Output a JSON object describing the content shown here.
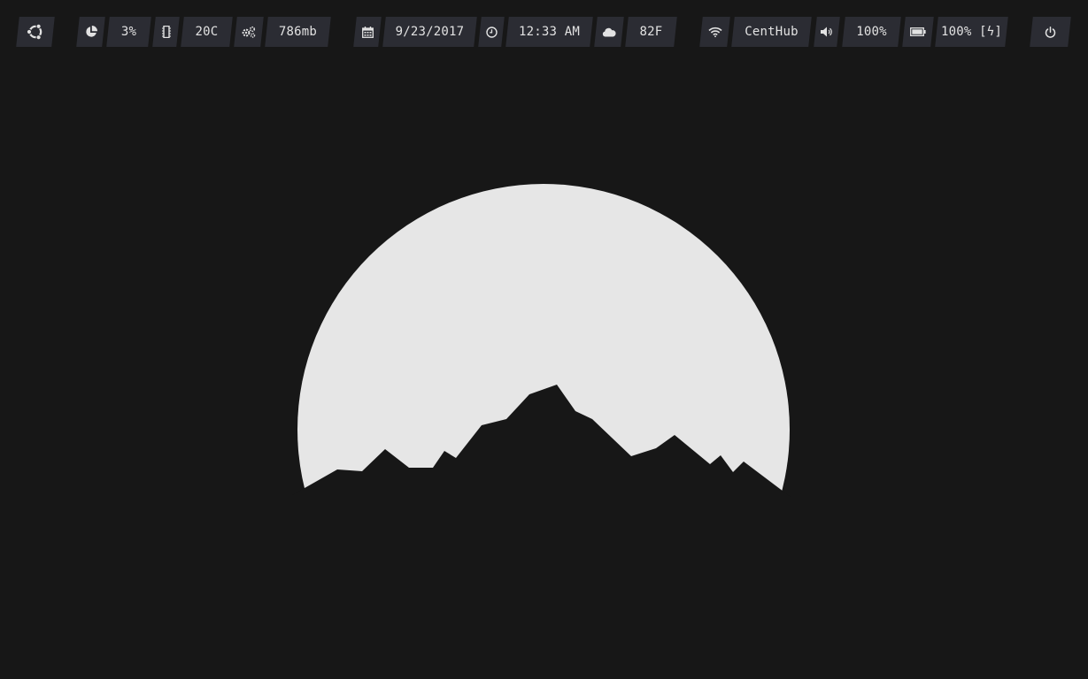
{
  "colors": {
    "background": "#171717",
    "bar_segment": "#2b2c33",
    "bar_text": "#e2e2e2",
    "moon": "#e6e6e6"
  },
  "statusbar": {
    "launcher": {
      "icon": "ubuntu-logo-icon"
    },
    "cpu": {
      "icon": "pie-chart-icon",
      "value": "3%"
    },
    "temperature": {
      "icon": "chip-icon",
      "value": "20C"
    },
    "memory": {
      "icon": "gears-icon",
      "value": "786mb"
    },
    "date": {
      "icon": "calendar-icon",
      "value": "9/23/2017"
    },
    "time": {
      "icon": "clock-icon",
      "value": "12:33 AM"
    },
    "weather": {
      "icon": "cloud-icon",
      "value": "82F"
    },
    "network": {
      "icon": "wifi-icon",
      "value": "CentHub"
    },
    "volume": {
      "icon": "speaker-icon",
      "value": "100%"
    },
    "battery": {
      "icon": "battery-icon",
      "value": "100% [ϟ]"
    },
    "power": {
      "icon": "power-icon"
    }
  },
  "wallpaper": {
    "description_icon": "moon-mountain-wallpaper"
  }
}
